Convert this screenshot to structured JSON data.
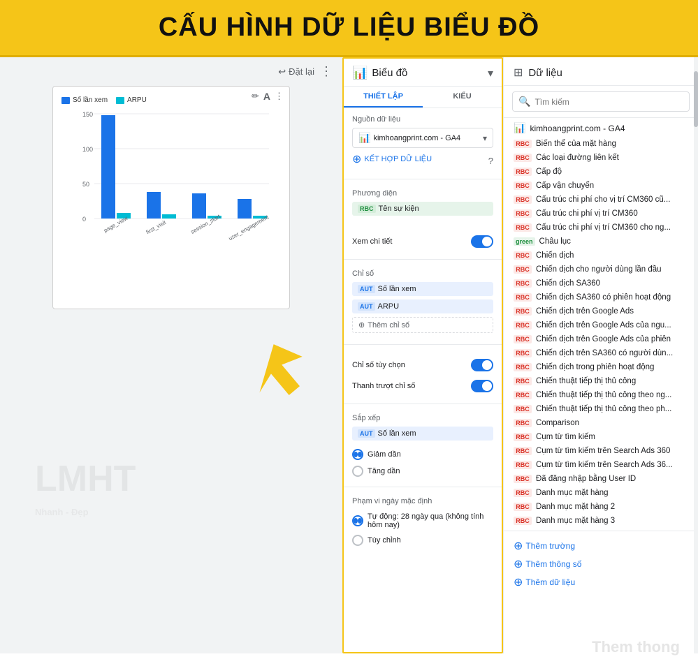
{
  "header": {
    "title": "CẤU HÌNH DỮ LIỆU BIỂU ĐỒ"
  },
  "toolbar": {
    "reset_label": "Đặt lại",
    "dots_label": "⋮"
  },
  "chart": {
    "legend": [
      {
        "label": "Số lần xem",
        "color": "#1a73e8"
      },
      {
        "label": "ARPU",
        "color": "#00bcd4"
      }
    ],
    "y_axis": [
      "150",
      "100",
      "50",
      "0"
    ],
    "x_axis": [
      "page_view",
      "first_visit",
      "session_start",
      "user_engagement"
    ]
  },
  "middle_panel": {
    "header": {
      "title": "Biểu đồ"
    },
    "tabs": [
      {
        "label": "THIẾT LẬP",
        "active": true
      },
      {
        "label": "KIỂU",
        "active": false
      }
    ],
    "source_section": {
      "label": "Nguồn dữ liệu",
      "value": "kimhoangprint.com - GA4",
      "blend_label": "KẾT HỢP DỮ LIỆU"
    },
    "dimension_section": {
      "label": "Phương diện",
      "chip_badge": "RBC",
      "chip_text": "Tên sự kiện"
    },
    "detail_toggle": {
      "label": "Xem chi tiết",
      "on": true
    },
    "metrics_section": {
      "label": "Chỉ số",
      "items": [
        {
          "badge": "AUT",
          "text": "Số lần xem"
        },
        {
          "badge": "AUT",
          "text": "ARPU"
        }
      ],
      "add_label": "Thêm chỉ số"
    },
    "custom_metric_toggle": {
      "label": "Chỉ số tùy chọn",
      "on": true
    },
    "slider_toggle": {
      "label": "Thanh trượt chỉ số",
      "on": true
    },
    "sort_section": {
      "label": "Sắp xếp",
      "chip_badge": "AUT",
      "chip_text": "Số lần xem",
      "options": [
        {
          "label": "Giảm dần",
          "selected": true
        },
        {
          "label": "Tăng dần",
          "selected": false
        }
      ]
    },
    "date_range_section": {
      "label": "Phạm vi ngày mặc định",
      "options": [
        {
          "label": "Tự động: 28 ngày qua (không tính hôm nay)",
          "selected": true
        },
        {
          "label": "Tùy chỉnh",
          "selected": false
        }
      ]
    }
  },
  "right_panel": {
    "title": "Dữ liệu",
    "search_placeholder": "Tìm kiếm",
    "source": "kimhoangprint.com - GA4",
    "items": [
      {
        "badge": "RBC",
        "badge_type": "rbc",
        "text": "Biến thể của mặt hàng"
      },
      {
        "badge": "RBC",
        "badge_type": "rbc",
        "text": "Các loại đường liên kết"
      },
      {
        "badge": "RBC",
        "badge_type": "rbc",
        "text": "Cấp độ"
      },
      {
        "badge": "RBC",
        "badge_type": "rbc",
        "text": "Cấp vận chuyển"
      },
      {
        "badge": "RBC",
        "badge_type": "rbc",
        "text": "Cấu trúc chi phí cho vị trí CM360 cũ..."
      },
      {
        "badge": "RBC",
        "badge_type": "rbc",
        "text": "Cấu trúc chi phí vị trí CM360"
      },
      {
        "badge": "RBC",
        "badge_type": "rbc",
        "text": "Cấu trúc chi phí vị trí CM360 cho ng..."
      },
      {
        "badge": "green",
        "badge_type": "green",
        "text": "Châu lục"
      },
      {
        "badge": "RBC",
        "badge_type": "rbc",
        "text": "Chiến dịch"
      },
      {
        "badge": "RBC",
        "badge_type": "rbc",
        "text": "Chiến dịch cho người dùng lần đầu"
      },
      {
        "badge": "RBC",
        "badge_type": "rbc",
        "text": "Chiến dịch SA360"
      },
      {
        "badge": "RBC",
        "badge_type": "rbc",
        "text": "Chiến dịch SA360 có phiên hoạt động"
      },
      {
        "badge": "RBC",
        "badge_type": "rbc",
        "text": "Chiến dịch trên Google Ads"
      },
      {
        "badge": "RBC",
        "badge_type": "rbc",
        "text": "Chiến dịch trên Google Ads của ngu..."
      },
      {
        "badge": "RBC",
        "badge_type": "rbc",
        "text": "Chiến dịch trên Google Ads của phiên"
      },
      {
        "badge": "RBC",
        "badge_type": "rbc",
        "text": "Chiến dịch trên SA360 có người dùn..."
      },
      {
        "badge": "RBC",
        "badge_type": "rbc",
        "text": "Chiến dịch trong phiên hoạt động"
      },
      {
        "badge": "RBC",
        "badge_type": "rbc",
        "text": "Chiến thuật tiếp thị thủ công"
      },
      {
        "badge": "RBC",
        "badge_type": "rbc",
        "text": "Chiến thuật tiếp thị thủ công theo ng..."
      },
      {
        "badge": "RBC",
        "badge_type": "rbc",
        "text": "Chiến thuật tiếp thị thủ công theo ph..."
      },
      {
        "badge": "RBC",
        "badge_type": "rbc",
        "text": "Comparison"
      },
      {
        "badge": "RBC",
        "badge_type": "rbc",
        "text": "Cụm từ tìm kiếm"
      },
      {
        "badge": "RBC",
        "badge_type": "rbc",
        "text": "Cụm từ tìm kiếm trên Search Ads 360"
      },
      {
        "badge": "RBC",
        "badge_type": "rbc",
        "text": "Cụm từ tìm kiếm trên Search Ads 36..."
      },
      {
        "badge": "RBC",
        "badge_type": "rbc",
        "text": "Đã đăng nhập bằng User ID"
      },
      {
        "badge": "RBC",
        "badge_type": "rbc",
        "text": "Danh mục mặt hàng"
      },
      {
        "badge": "RBC",
        "badge_type": "rbc",
        "text": "Danh mục mặt hàng 2"
      },
      {
        "badge": "RBC",
        "badge_type": "rbc",
        "text": "Danh mục mặt hàng 3"
      }
    ],
    "footer": [
      {
        "icon": "+",
        "label": "Thêm trường"
      },
      {
        "icon": "+",
        "label": "Thêm thông số"
      },
      {
        "icon": "+",
        "label": "Thêm dữ liệu"
      }
    ]
  },
  "watermark": {
    "logo": "LMHT",
    "sub": "Nhanh - Đẹp",
    "bottom_text": "Them thong"
  }
}
